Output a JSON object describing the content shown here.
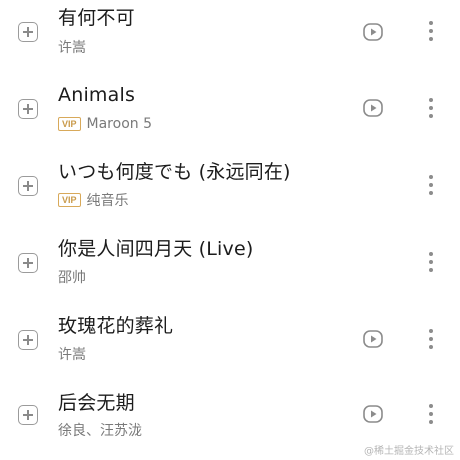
{
  "songs": [
    {
      "title": "有何不可",
      "artist": "许嵩",
      "vip": false,
      "play_available": true
    },
    {
      "title": "Animals",
      "artist": "Maroon 5",
      "vip": true,
      "play_available": true
    },
    {
      "title": "いつも何度でも (永远同在)",
      "artist": "纯音乐",
      "vip": true,
      "play_available": false
    },
    {
      "title": "你是人间四月天 (Live)",
      "artist": "邵帅",
      "vip": false,
      "play_available": false
    },
    {
      "title": "玫瑰花的葬礼",
      "artist": "许嵩",
      "vip": false,
      "play_available": true
    },
    {
      "title": "后会无期",
      "artist": "徐良、汪苏泷",
      "vip": false,
      "play_available": true
    }
  ],
  "vip_label": "VIP",
  "icons": {
    "add": "plus-square-icon",
    "play": "play-circle-icon",
    "more": "more-vertical-icon"
  },
  "colors": {
    "vip_gold": "#c99a4a",
    "icon_gray": "#8c8c8c"
  },
  "watermark": "@稀土掘金技术社区"
}
